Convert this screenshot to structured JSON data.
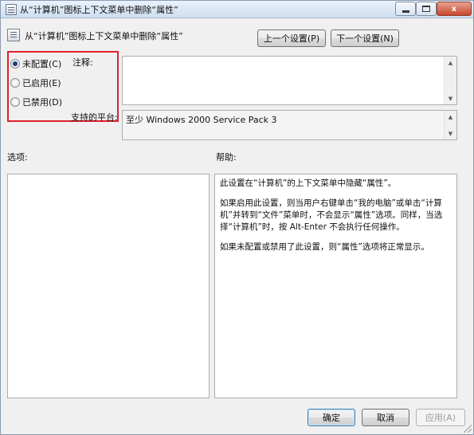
{
  "window": {
    "title": "从“计算机”图标上下文菜单中删除“属性”",
    "controls": {
      "minimize": "minimize",
      "maximize": "maximize",
      "close": "x"
    }
  },
  "header": {
    "title": "从“计算机”图标上下文菜单中删除“属性”",
    "prev_label": "上一个设置(P)",
    "next_label": "下一个设置(N)"
  },
  "state": {
    "options": [
      {
        "label": "未配置(C)",
        "checked": true
      },
      {
        "label": "已启用(E)",
        "checked": false
      },
      {
        "label": "已禁用(D)",
        "checked": false
      }
    ]
  },
  "comment": {
    "label": "注释:",
    "value": ""
  },
  "platform": {
    "label": "支持的平台:",
    "value": "至少 Windows 2000 Service Pack 3"
  },
  "options_panel": {
    "label": "选项:"
  },
  "help_panel": {
    "label": "帮助:",
    "paragraphs": [
      "此设置在“计算机”的上下文菜单中隐藏“属性”。",
      "如果启用此设置，则当用户右键单击“我的电脑”或单击“计算机”并转到“文件”菜单时，不会显示“属性”选项。同样，当选择“计算机”时，按 Alt-Enter 不会执行任何操作。",
      "如果未配置或禁用了此设置，则“属性”选项将正常显示。"
    ]
  },
  "footer": {
    "ok_label": "确定",
    "cancel_label": "取消",
    "apply_label": "应用(A)"
  },
  "colors": {
    "highlight_box": "#e0202c",
    "window_bg": "#f0f0f0"
  }
}
